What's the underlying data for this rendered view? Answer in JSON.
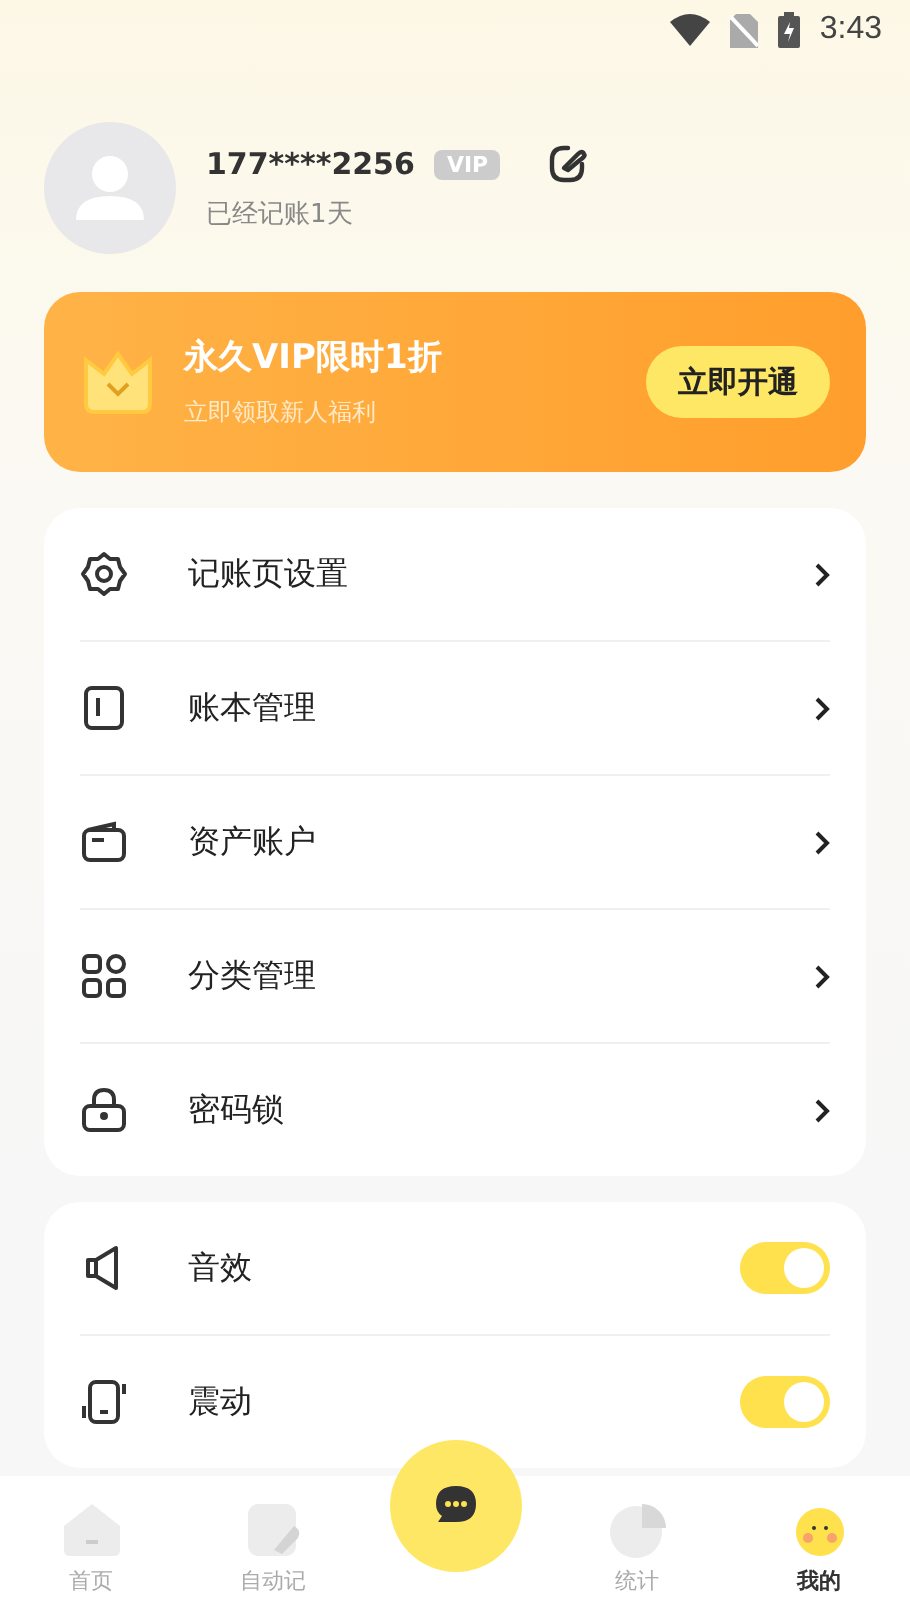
{
  "status_bar": {
    "time": "3:43"
  },
  "profile": {
    "name": "177****2256",
    "badge": "VIP",
    "subtitle": "已经记账1天"
  },
  "promo": {
    "title": "永久VIP限时1折",
    "subtitle": "立即领取新人福利",
    "button": "立即开通"
  },
  "menu": [
    {
      "label": "记账页设置",
      "kind": "gear"
    },
    {
      "label": "账本管理",
      "kind": "book"
    },
    {
      "label": "资产账户",
      "kind": "wallet"
    },
    {
      "label": "分类管理",
      "kind": "grid"
    },
    {
      "label": "密码锁",
      "kind": "lock"
    }
  ],
  "toggles": [
    {
      "label": "音效",
      "kind": "speaker",
      "on": true
    },
    {
      "label": "震动",
      "kind": "vibrate",
      "on": true
    }
  ],
  "nav": [
    {
      "label": "首页",
      "kind": "home",
      "selected": false
    },
    {
      "label": "自动记",
      "kind": "note",
      "selected": false
    },
    {
      "kind": "fab"
    },
    {
      "label": "统计",
      "kind": "chart",
      "selected": false
    },
    {
      "label": "我的",
      "kind": "me",
      "selected": true
    }
  ]
}
